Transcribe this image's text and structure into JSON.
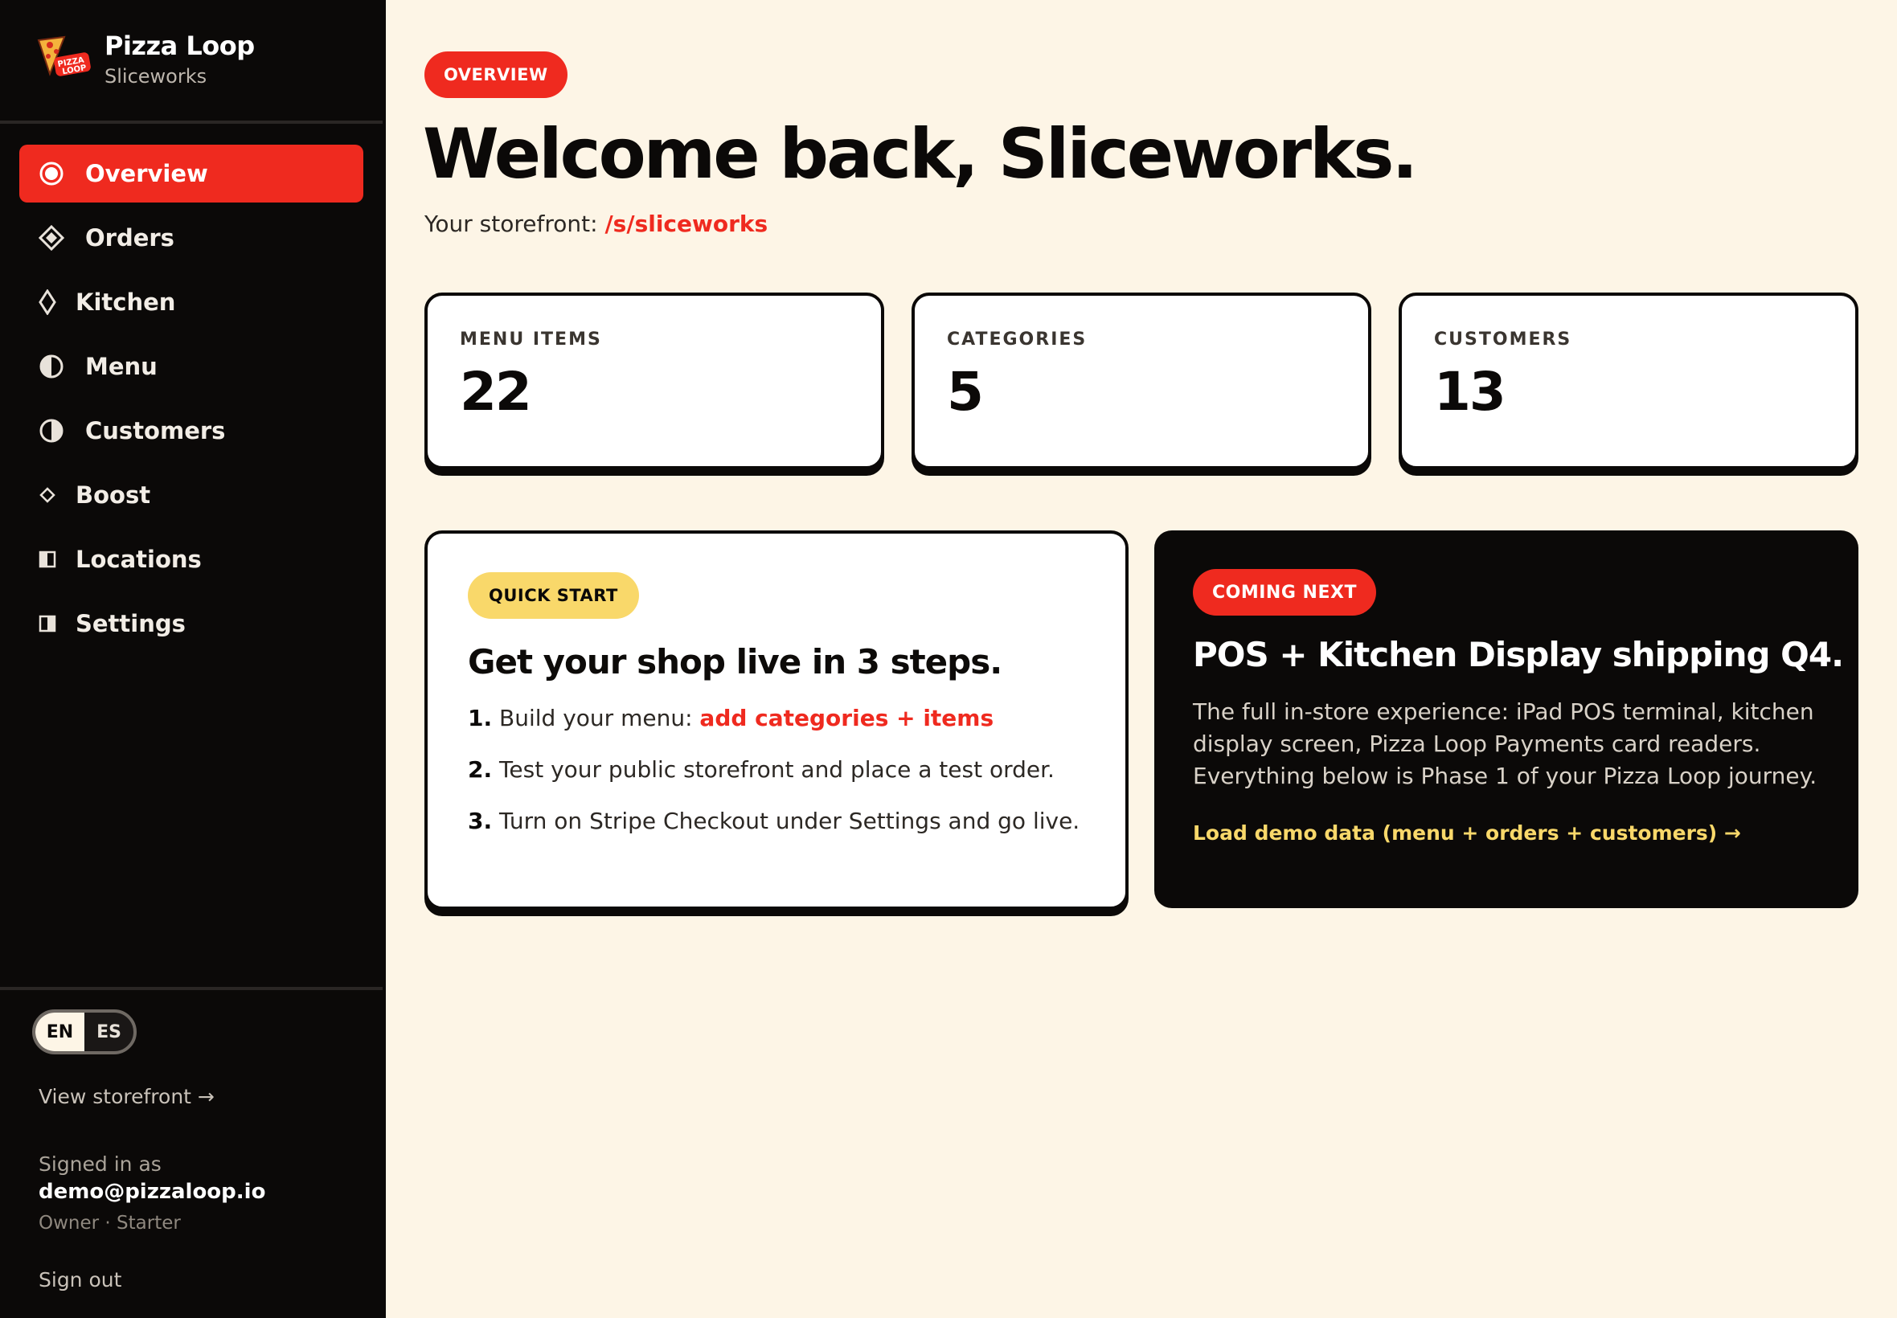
{
  "brand": {
    "name": "Pizza Loop",
    "shop": "Sliceworks",
    "logo_text": "PIZZA LOOP"
  },
  "sidebar": {
    "items": [
      {
        "label": "Overview",
        "icon": "target-icon",
        "active": true
      },
      {
        "label": "Orders",
        "icon": "diamond-filled-icon",
        "active": false
      },
      {
        "label": "Kitchen",
        "icon": "diamond-outline-icon",
        "active": false
      },
      {
        "label": "Menu",
        "icon": "half-circle-icon",
        "active": false
      },
      {
        "label": "Customers",
        "icon": "half-circle-icon",
        "active": false
      },
      {
        "label": "Boost",
        "icon": "small-diamond-icon",
        "active": false
      },
      {
        "label": "Locations",
        "icon": "half-square-icon",
        "active": false
      },
      {
        "label": "Settings",
        "icon": "half-square-icon",
        "active": false
      }
    ],
    "lang": {
      "en": "EN",
      "es": "ES",
      "selected": "EN"
    },
    "view_storefront": "View storefront →",
    "signed_in_label": "Signed in as",
    "email": "demo@pizzaloop.io",
    "role": "Owner · Starter",
    "sign_out": "Sign out"
  },
  "main": {
    "badge": "OVERVIEW",
    "welcome": "Welcome back, Sliceworks.",
    "storefront_prefix": "Your storefront:",
    "storefront_link": "/s/sliceworks",
    "stats": [
      {
        "label": "MENU ITEMS",
        "value": "22"
      },
      {
        "label": "CATEGORIES",
        "value": "5"
      },
      {
        "label": "CUSTOMERS",
        "value": "13"
      }
    ],
    "quick_start": {
      "badge": "QUICK START",
      "title": "Get your shop live in 3 steps.",
      "step1_num": "1.",
      "step1_text": "Build your menu:",
      "step1_link": "add categories + items",
      "step2_num": "2.",
      "step2_text": "Test your public storefront and place a test order.",
      "step3_num": "3.",
      "step3_text": "Turn on Stripe Checkout under Settings and go live."
    },
    "coming_next": {
      "badge": "COMING NEXT",
      "title": "POS + Kitchen Display shipping Q4.",
      "body": "The full in-store experience: iPad POS terminal, kitchen display screen, Pizza Loop Payments card readers. Everything below is Phase 1 of your Pizza Loop journey.",
      "demo_link": "Load demo data (menu + orders + customers) →"
    }
  },
  "colors": {
    "accent": "#ef2a1f",
    "background": "#fdf5e6",
    "sidebar": "#0b0908",
    "highlight": "#f9d86a"
  }
}
